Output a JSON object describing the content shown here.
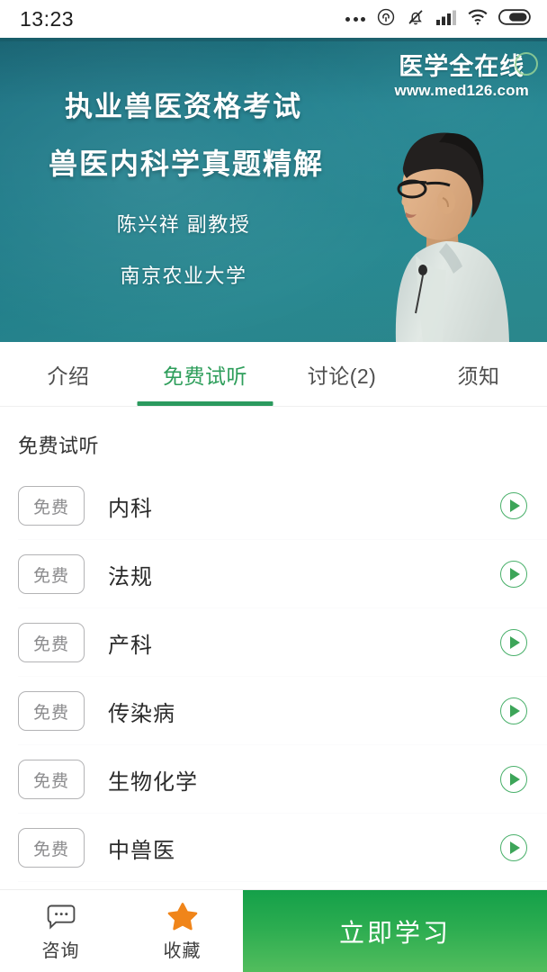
{
  "statusbar": {
    "time": "13:23",
    "icons": [
      "more-dots-icon",
      "cast-icon",
      "bell-muted-icon",
      "signal-bars-icon",
      "wifi-icon",
      "battery-icon"
    ]
  },
  "hero": {
    "watermark_cn": "医学全在线",
    "watermark_url": "www.med126.com",
    "title_line1": "执业兽医资格考试",
    "title_line2": "兽医内科学真题精解",
    "subtitle_line1": "陈兴祥  副教授",
    "subtitle_line2": "南京农业大学",
    "background_color": "#1f7f8d"
  },
  "tabs": [
    {
      "label": "介绍",
      "active": false
    },
    {
      "label": "免费试听",
      "active": true
    },
    {
      "label": "讨论(2)",
      "active": false
    },
    {
      "label": "须知",
      "active": false
    }
  ],
  "main": {
    "section_title": "免费试听",
    "badge_label": "免费",
    "lessons": [
      {
        "badge": "免费",
        "name": "内科"
      },
      {
        "badge": "免费",
        "name": "法规"
      },
      {
        "badge": "免费",
        "name": "产科"
      },
      {
        "badge": "免费",
        "name": "传染病"
      },
      {
        "badge": "免费",
        "name": "生物化学"
      },
      {
        "badge": "免费",
        "name": "中兽医"
      }
    ]
  },
  "bottombar": {
    "consult_label": "咨询",
    "favorite_label": "收藏",
    "cta_label": "立即学习",
    "cta_color": "#2bac50",
    "star_color": "#f0851a"
  }
}
